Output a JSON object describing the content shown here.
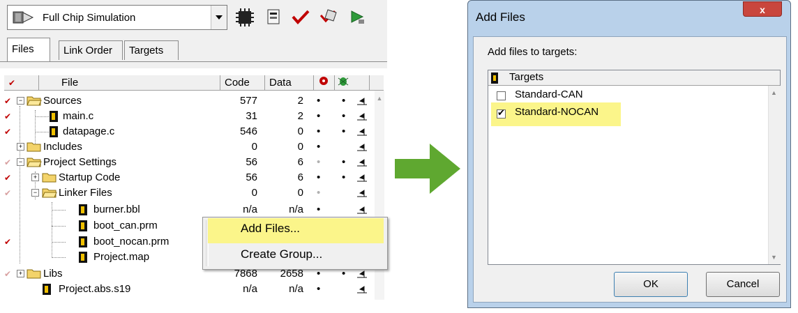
{
  "toolbar": {
    "target_value": "Full Chip Simulation"
  },
  "tabs": [
    "Files",
    "Link Order",
    "Targets"
  ],
  "columns": {
    "file": "File",
    "code": "Code",
    "data": "Data"
  },
  "rows": [
    {
      "name": "Sources",
      "code": "577",
      "data": "2"
    },
    {
      "name": "main.c",
      "code": "31",
      "data": "2"
    },
    {
      "name": "datapage.c",
      "code": "546",
      "data": "0"
    },
    {
      "name": "Includes",
      "code": "0",
      "data": "0"
    },
    {
      "name": "Project Settings",
      "code": "56",
      "data": "6"
    },
    {
      "name": "Startup Code",
      "code": "56",
      "data": "6"
    },
    {
      "name": "Linker Files",
      "code": "0",
      "data": "0"
    },
    {
      "name": "burner.bbl",
      "code": "n/a",
      "data": "n/a"
    },
    {
      "name": "boot_can.prm",
      "code": "",
      "data": ""
    },
    {
      "name": "boot_nocan.prm",
      "code": "",
      "data": ""
    },
    {
      "name": "Project.map",
      "code": "",
      "data": ""
    },
    {
      "name": "Libs",
      "code": "7868",
      "data": "2658"
    },
    {
      "name": "Project.abs.s19",
      "code": "n/a",
      "data": "n/a"
    }
  ],
  "bullet": "•",
  "context_menu": {
    "add_files": "Add Files...",
    "create_group": "Create Group..."
  },
  "dialog": {
    "title": "Add Files",
    "close": "x",
    "prompt": "Add files to targets:",
    "list_header": "Targets",
    "options": [
      {
        "label": "Standard-CAN",
        "checked": false
      },
      {
        "label": "Standard-NOCAN",
        "checked": true
      }
    ],
    "ok": "OK",
    "cancel": "Cancel"
  },
  "colors": {
    "highlight": "#fbf58a",
    "arrow": "#5fa830",
    "check_mark": "#c00000"
  }
}
